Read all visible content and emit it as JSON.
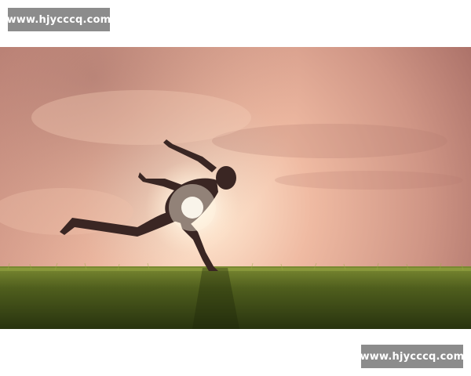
{
  "watermark": {
    "top_text": "www.hjycccq.com",
    "bottom_text": "www.hjycccq.com"
  },
  "photo": {
    "subject": "silhouette-of-person-running-at-sunset",
    "colors": {
      "sky_top": "#b97b70",
      "sky_glow": "#fde6d3",
      "grass_dark": "#2e3a14",
      "grass_light": "#6f7f2a"
    }
  }
}
